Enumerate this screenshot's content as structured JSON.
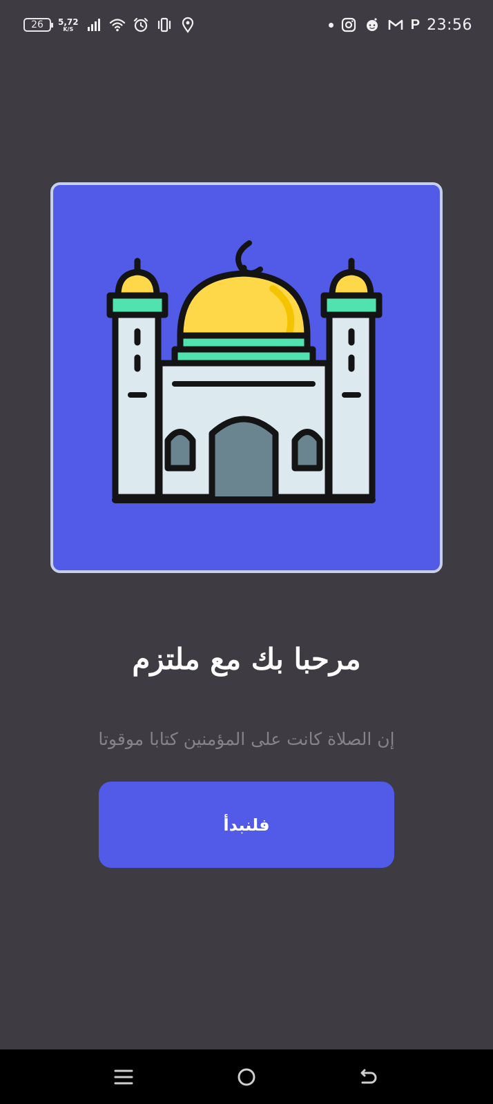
{
  "status_bar": {
    "battery_level": "26",
    "net_speed": "5,72",
    "net_speed_unit": "K/S",
    "time": "23:56",
    "left_icons": [
      "signal-icon",
      "wifi-icon",
      "alarm-icon",
      "vibrate-icon",
      "location-icon"
    ],
    "right_icons": [
      "notification-dot",
      "instagram-icon",
      "reddit-icon",
      "gmail-icon",
      "p-app-icon"
    ],
    "p_app_letter": "P"
  },
  "hero": {
    "image": "mosque-illustration",
    "background_color": "#515be7",
    "border_color": "#c7cfea"
  },
  "welcome": {
    "title": "مرحبا بك مع ملتزم",
    "subtitle": "إن الصلاة كانت على المؤمنين كتابا موقوتا"
  },
  "actions": {
    "start_label": "فلنبدأ"
  },
  "nav_bar": {
    "buttons": [
      "menu-icon",
      "home-icon",
      "back-icon"
    ]
  }
}
